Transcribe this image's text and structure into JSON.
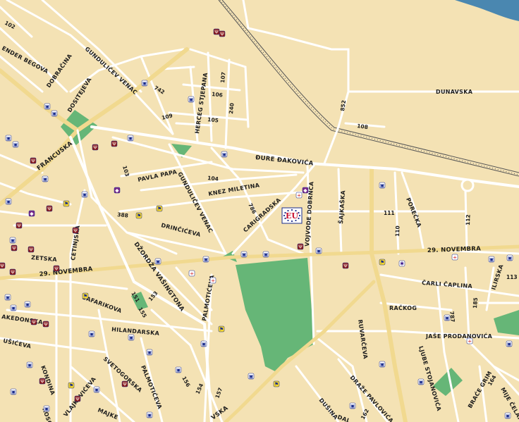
{
  "colors": {
    "background": "#f4e2b4",
    "water": "#4a87b0",
    "park": "#66b677",
    "major_road": "#f1d98f",
    "minor_road": "#ffffff",
    "eu_marker_bg": "#ffffff",
    "eu_marker_text": "#c8102e",
    "eu_marker_stars": "#1a2c8c"
  },
  "map": {
    "streets": {
      "dunavska": "DUNAVSKA",
      "djure_djakovica": "ĐURE ĐAKOVIĆA",
      "gundulicev_venac_top": "GUNDULIČEV VENAC",
      "gundulicev_venac_mid": "GUNDULIČEV VENAC",
      "dobraczina": "DOBRAČINA",
      "dositejeva": "DOSITEJEVA",
      "francuska": "FRANCUSKA",
      "ender_begova": "ENDER BEGOVA",
      "herceg_stjepana": "HERCEG STJEPANA",
      "pavla_papa": "PAVLA PAPA",
      "knez_miletina": "KNEZ MILETINA",
      "carigradska": "CARIGRADSKA",
      "vojvode_dobrnca": "VOJVODE DOBRNCA",
      "sajkaska": "ŠAJKAŠKA",
      "porecka": "POREČKA",
      "drinciceva": "DRINČIĆEVA",
      "dzordza_vasingtona": "DŽORDŽA VAŠINGTONA",
      "cetinjska": "CETINJSKA",
      "zetska": "ZETSKA",
      "dvadesetdevet_novembra_left": "29. NOVEMBRA",
      "dvadesetdevet_novembra_right": "29. NOVEMBRA",
      "palmoticeva_top": "PALMOTIĆEVA",
      "palmoticeva_bottom": "PALMOTIĆEVA",
      "safarikova": "ŠAFARIKOVA",
      "makedonska": "AKEDONSKA",
      "hilandarska": "HILANDARSKA",
      "kusiceva": "UŠIĆEVA",
      "kondina": "KONDINA",
      "svetogorska": "SVETOGORSKA",
      "vlajkoviceva": "VLAJKOVIĆEVA",
      "majke": "MAJKE",
      "koso": "KOSO",
      "ruzveltova": "RUVARČEVA",
      "drazе_pavlovica": "DRAŽE PAVLOVIĆA",
      "dusina": "DUŠINA",
      "dal": "DAL",
      "vska": "VSKA",
      "rackog": "RAČKOG",
      "carli_caplina": "ČARLI ČAPLINA",
      "ilirska": "ILIRSKA",
      "jase_prodanovica": "JAŠE PRODANOVIĆA",
      "ljube_stojanovica": "LJUBE STOJANOVIĆA",
      "brace_grim": "BRAĆE GRIM",
      "mije_celara": "MIJE ČELARA"
    },
    "numbers": {
      "n102": "102",
      "n742": "742",
      "n107": "107",
      "n106": "106",
      "n109": "109",
      "n105": "105",
      "n240": "240",
      "n852": "852",
      "n108": "108",
      "n103": "103",
      "n104": "104",
      "n786": "786",
      "n388": "388",
      "n111": "111",
      "n110": "110",
      "n112": "112",
      "n113": "113",
      "n787": "787",
      "n185": "185",
      "n151": "151",
      "n153": "153",
      "n155": "155",
      "n156": "156",
      "n154": "154",
      "n157": "157",
      "n162": "162",
      "n164": "164"
    },
    "eu_marker": "EU"
  }
}
